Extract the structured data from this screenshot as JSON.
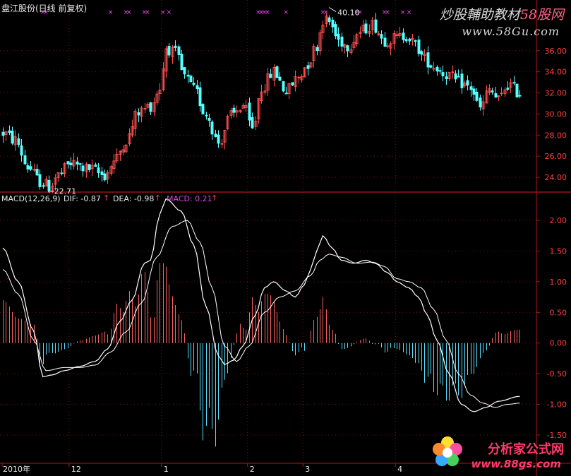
{
  "header": {
    "stock_title": "盘江股份(日线 前复权)",
    "macd_label": "MACD(12,26,9)",
    "dif_label": "DIF: -0.87",
    "dea_label": "DEA: -0.98",
    "macd_value_label": "MACD: 0.21",
    "arrow": "↑"
  },
  "watermarks": {
    "top_line1_text": "炒股輔助教材",
    "top_line1_num": "58股网",
    "top_line2": "www.58Gu.com",
    "bottom_line1": "分析家公式网",
    "bottom_line2": "www.88gs.com"
  },
  "colors": {
    "background": "#000000",
    "axis_red": "#b01818",
    "grid": "#7a1010",
    "up_candle": "#ff4f4f",
    "down_candle": "#54ffff",
    "macd_up": "#ff6060",
    "macd_down": "#54e0ff",
    "line": "#ffffff",
    "macd_text": "#e040e0",
    "axis_text": "#ff4040",
    "info_marker": "#ff40ff"
  },
  "chart_data": [
    {
      "type": "candlestick",
      "title": "盘江股份(日线 前复权)",
      "ylim": [
        22.6,
        39.8
      ],
      "yticks": [
        24,
        26,
        28,
        30,
        32,
        34,
        36
      ],
      "ytick_labels": [
        "24.00",
        "26.00",
        "28.00",
        "30.00",
        "32.00",
        "34.00",
        "36.00"
      ],
      "annotations": [
        {
          "text": "40.10",
          "value": 40.1,
          "bar_index": 106,
          "label": "40.10"
        },
        {
          "text": "←22.71",
          "value": 22.71,
          "bar_index": 15,
          "label": "22.71"
        }
      ],
      "info_marker_bars": [
        13,
        14,
        35,
        40,
        41,
        46,
        47,
        52,
        54,
        83,
        84,
        85,
        86,
        92,
        104,
        105,
        115,
        116,
        124,
        125,
        130,
        132
      ],
      "x_labels": [
        {
          "text": "2010年",
          "bar_index": 0
        },
        {
          "text": "12",
          "bar_index": 22
        },
        {
          "text": "1",
          "bar_index": 52
        },
        {
          "text": "2",
          "bar_index": 80
        },
        {
          "text": "3",
          "bar_index": 98
        },
        {
          "text": "4",
          "bar_index": 128
        }
      ]
    },
    {
      "type": "macd",
      "params": "MACD(12,26,9)",
      "dif": -0.87,
      "dea": -0.98,
      "macd": 0.21,
      "ylim": [
        -1.95,
        2.45
      ],
      "yticks": [
        -1.5,
        -1.0,
        -0.5,
        0,
        0.5,
        1.0,
        1.5,
        2.0
      ],
      "ytick_labels": [
        "-1.50",
        "-1.00",
        "-0.50",
        "0.00",
        "0.50",
        "1.00",
        "1.50",
        "2.00"
      ],
      "dif_anchors": [
        [
          0,
          1.55
        ],
        [
          5,
          1.0
        ],
        [
          10,
          0.2
        ],
        [
          13,
          -0.55
        ],
        [
          16,
          -0.52
        ],
        [
          20,
          -0.45
        ],
        [
          25,
          -0.38
        ],
        [
          30,
          -0.3
        ],
        [
          34,
          -0.1
        ],
        [
          38,
          0.35
        ],
        [
          42,
          0.7
        ],
        [
          46,
          1.3
        ],
        [
          48,
          1.35
        ],
        [
          51,
          2.1
        ],
        [
          53,
          2.35
        ],
        [
          58,
          2.15
        ],
        [
          62,
          1.6
        ],
        [
          66,
          0.6
        ],
        [
          70,
          -0.2
        ],
        [
          72,
          -0.35
        ],
        [
          75,
          -0.28
        ],
        [
          78,
          -0.05
        ],
        [
          82,
          0.45
        ],
        [
          85,
          0.9
        ],
        [
          88,
          1.0
        ],
        [
          92,
          0.85
        ],
        [
          95,
          0.75
        ],
        [
          98,
          0.95
        ],
        [
          100,
          1.2
        ],
        [
          102,
          1.5
        ],
        [
          104,
          1.75
        ],
        [
          107,
          1.55
        ],
        [
          110,
          1.35
        ],
        [
          114,
          1.3
        ],
        [
          118,
          1.35
        ],
        [
          121,
          1.3
        ],
        [
          125,
          1.15
        ],
        [
          128,
          1.0
        ],
        [
          132,
          0.9
        ],
        [
          135,
          0.75
        ],
        [
          138,
          0.45
        ],
        [
          141,
          0.05
        ],
        [
          145,
          -0.5
        ],
        [
          149,
          -1.0
        ],
        [
          153,
          -1.12
        ],
        [
          157,
          -1.05
        ],
        [
          161,
          -0.95
        ],
        [
          168,
          -0.87
        ]
      ],
      "dea_anchors": [
        [
          0,
          1.2
        ],
        [
          5,
          0.8
        ],
        [
          10,
          0.05
        ],
        [
          14,
          -0.45
        ],
        [
          20,
          -0.4
        ],
        [
          25,
          -0.4
        ],
        [
          30,
          -0.36
        ],
        [
          35,
          -0.15
        ],
        [
          40,
          0.18
        ],
        [
          45,
          0.65
        ],
        [
          50,
          1.4
        ],
        [
          55,
          1.9
        ],
        [
          60,
          2.0
        ],
        [
          64,
          1.65
        ],
        [
          68,
          0.9
        ],
        [
          72,
          -0.05
        ],
        [
          76,
          -0.3
        ],
        [
          80,
          -0.05
        ],
        [
          85,
          0.5
        ],
        [
          90,
          0.75
        ],
        [
          95,
          0.85
        ],
        [
          100,
          1.1
        ],
        [
          103,
          1.35
        ],
        [
          106,
          1.45
        ],
        [
          110,
          1.4
        ],
        [
          115,
          1.3
        ],
        [
          120,
          1.32
        ],
        [
          124,
          1.25
        ],
        [
          128,
          1.05
        ],
        [
          132,
          1.0
        ],
        [
          136,
          0.9
        ],
        [
          140,
          0.55
        ],
        [
          144,
          0.05
        ],
        [
          148,
          -0.5
        ],
        [
          152,
          -0.85
        ],
        [
          156,
          -0.98
        ],
        [
          160,
          -1.05
        ],
        [
          164,
          -1.0
        ],
        [
          168,
          -0.98
        ]
      ]
    }
  ]
}
